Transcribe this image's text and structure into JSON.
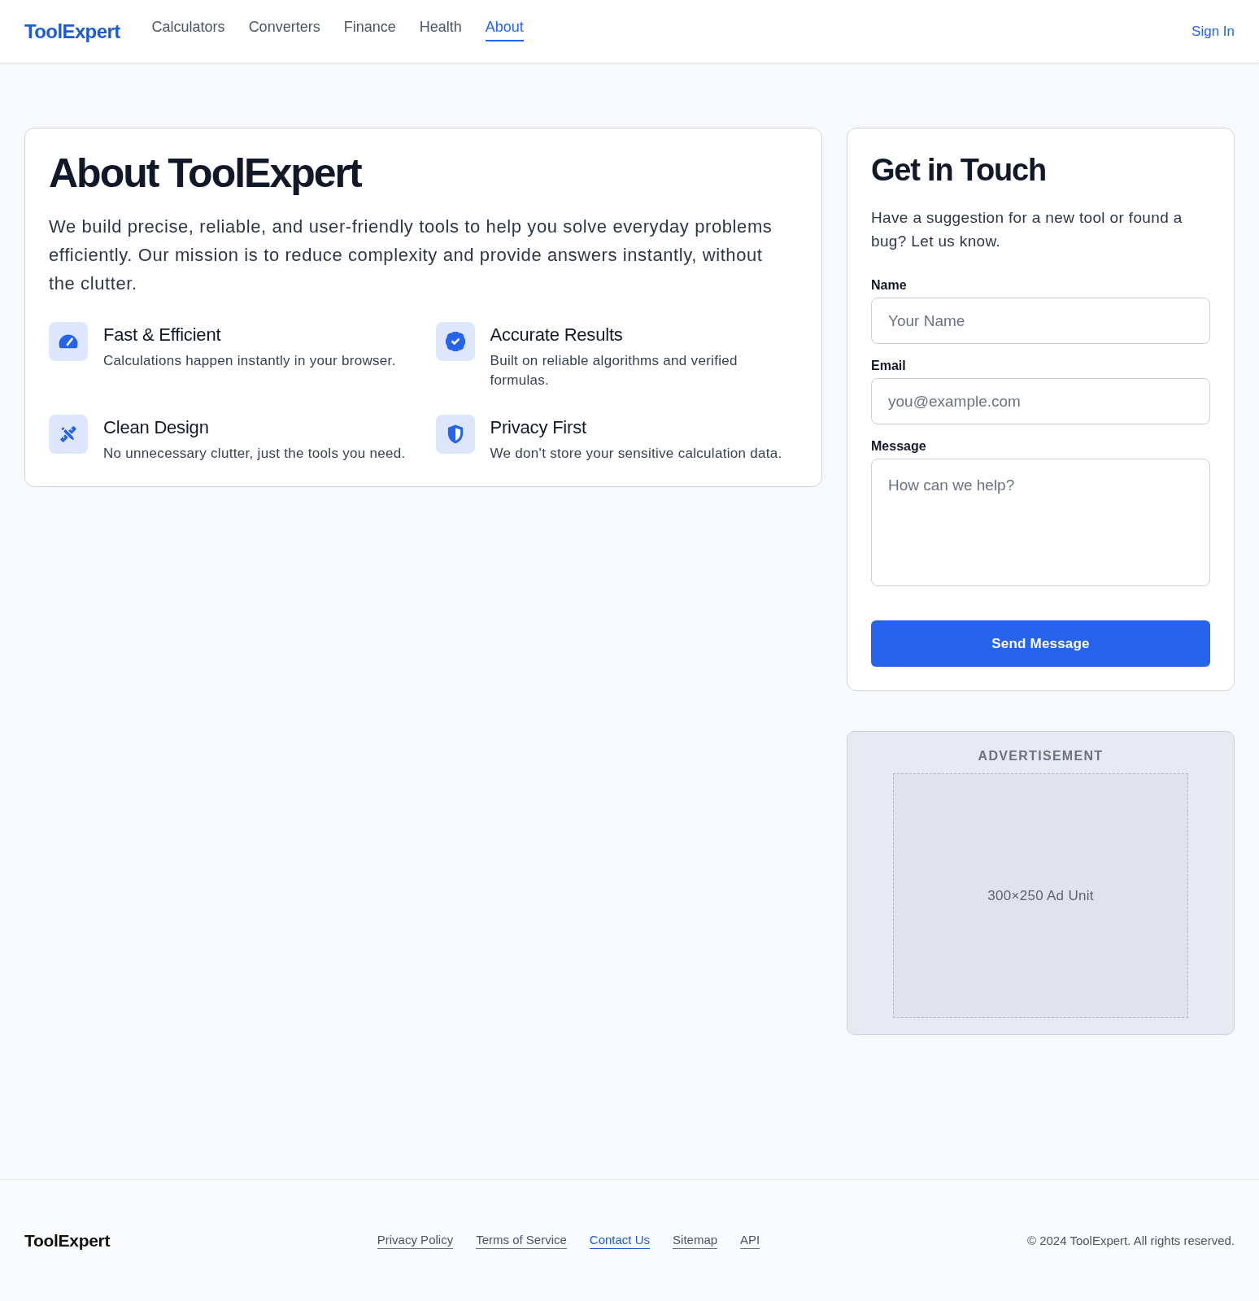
{
  "header": {
    "logo": "ToolExpert",
    "nav": [
      {
        "label": "Calculators",
        "selected": false
      },
      {
        "label": "Converters",
        "selected": false
      },
      {
        "label": "Finance",
        "selected": false
      },
      {
        "label": "Health",
        "selected": false
      },
      {
        "label": "About",
        "selected": true
      }
    ],
    "sign_in": "Sign In"
  },
  "about": {
    "title": "About ToolExpert",
    "intro": "We build precise, reliable, and user-friendly tools to help you solve everyday problems efficiently. Our mission is to reduce complexity and provide answers instantly, without the clutter.",
    "features": [
      {
        "title": "Fast & Efficient",
        "description": "Calculations happen instantly in your browser."
      },
      {
        "title": "Accurate Results",
        "description": "Built on reliable algorithms and verified formulas."
      },
      {
        "title": "Clean Design",
        "description": "No unnecessary clutter, just the tools you need."
      },
      {
        "title": "Privacy First",
        "description": "We don't store your sensitive calculation data."
      }
    ]
  },
  "contact": {
    "title": "Get in Touch",
    "description": "Have a suggestion for a new tool or found a bug? Let us know.",
    "fields": [
      {
        "kind": "input",
        "label": "Name",
        "placeholder": "Your Name"
      },
      {
        "kind": "input",
        "label": "Email",
        "placeholder": "you@example.com"
      },
      {
        "kind": "textarea",
        "label": "Message",
        "placeholder": "How can we help?"
      }
    ],
    "submit": "Send Message"
  },
  "ad": {
    "label": "ADVERTISEMENT",
    "slot": "300×250 Ad Unit"
  },
  "footer": {
    "logo": "ToolExpert",
    "links": [
      {
        "label": "Privacy Policy",
        "selected": false
      },
      {
        "label": "Terms of Service",
        "selected": false
      },
      {
        "label": "Contact Us",
        "selected": true
      },
      {
        "label": "Sitemap",
        "selected": false
      },
      {
        "label": "API",
        "selected": false
      }
    ],
    "copyright": "© 2024 ToolExpert. All rights reserved."
  }
}
